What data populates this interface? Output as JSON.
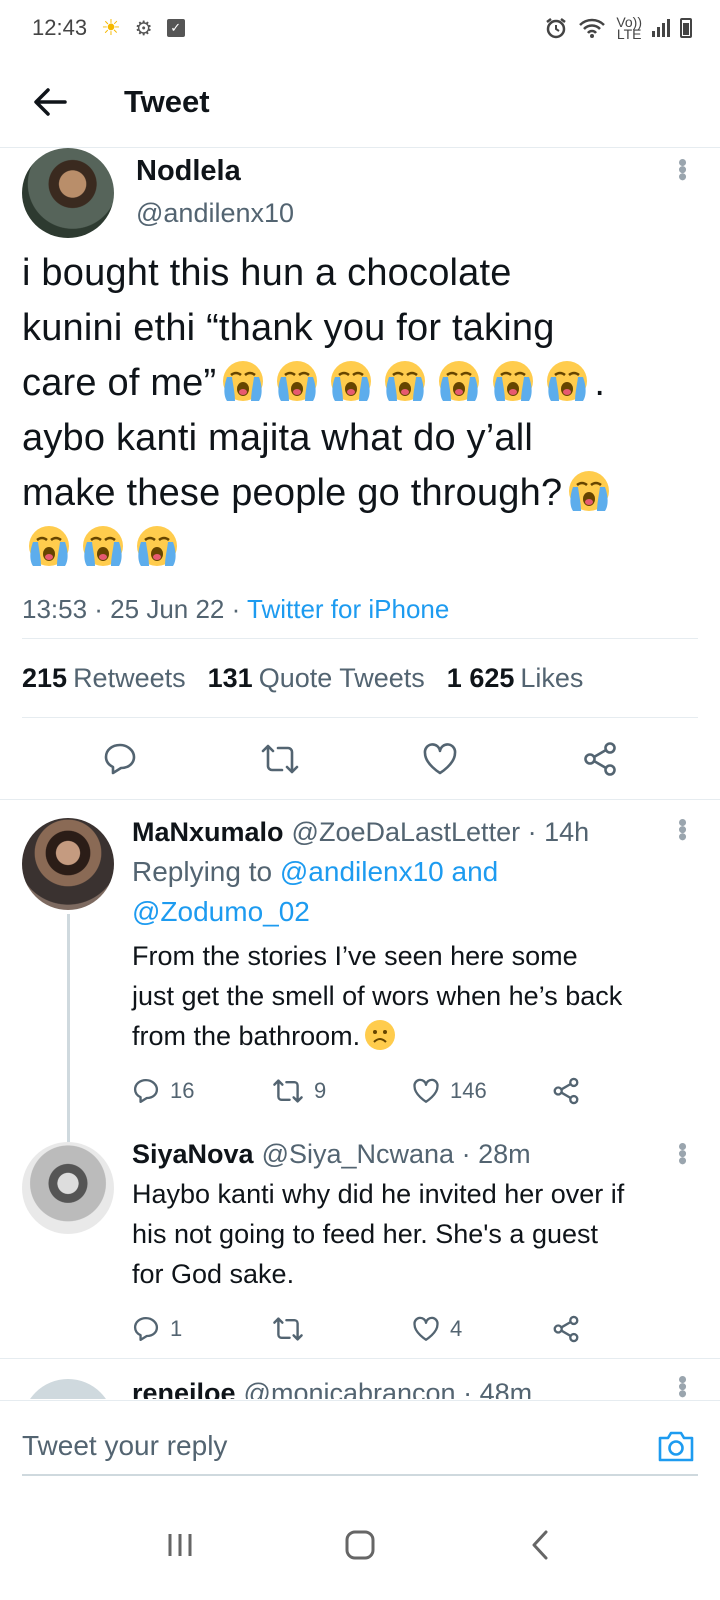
{
  "status_bar": {
    "time": "12:43",
    "volte_top": "Vo))",
    "volte_bottom": "LTE"
  },
  "header": {
    "title": "Tweet"
  },
  "main_tweet": {
    "display_name": "Nodlela",
    "handle": "@andilenx10",
    "text_line1": "i bought this hun a chocolate",
    "text_line2": "kunini ethi “thank you for taking",
    "text_line3": "care of me”",
    "text_line3_end": ".",
    "text_line4": "aybo kanti majita what do y’all",
    "text_line5": "make these people go through?",
    "time": "13:53 · 25 Jun 22 · ",
    "source": "Twitter for iPhone",
    "stats": {
      "retweets_count": "215",
      "retweets_label": "Retweets",
      "quotes_count": "131",
      "quotes_label": "Quote Tweets",
      "likes_count": "1 625",
      "likes_label": "Likes"
    },
    "icons": [
      "reply-icon",
      "retweet-icon",
      "like-icon",
      "share-icon"
    ]
  },
  "replies": [
    {
      "display_name": "MaNxumalo",
      "handle": "@ZoeDaLastLetter",
      "time": "· 14h",
      "replying_prefix": "Replying to",
      "replying_to": "@andilenx10 and",
      "replying_to2": "@Zodumo_02",
      "text_line1": "From the stories I’ve seen here some",
      "text_line2": "just get the smell of wors when he’s back",
      "text_line3": "from the bathroom.",
      "reply_count": "16",
      "retweet_count": "9",
      "like_count": "146"
    },
    {
      "display_name": "SiyaNova",
      "handle": "@Siya_Ncwana",
      "time": "· 28m",
      "text_line1": "Haybo kanti why did he invited her over if",
      "text_line2": "his not going to feed her. She's a guest",
      "text_line3": "for God sake.",
      "reply_count": "1",
      "retweet_count": "",
      "like_count": "4"
    },
    {
      "display_name": "reneiloe",
      "handle": "@monicabrancon",
      "time": "· 48m"
    }
  ],
  "composer": {
    "placeholder": "Tweet your reply"
  },
  "colors": {
    "accent": "#1d9bf0",
    "text": "#0f1419",
    "muted": "#536471"
  }
}
